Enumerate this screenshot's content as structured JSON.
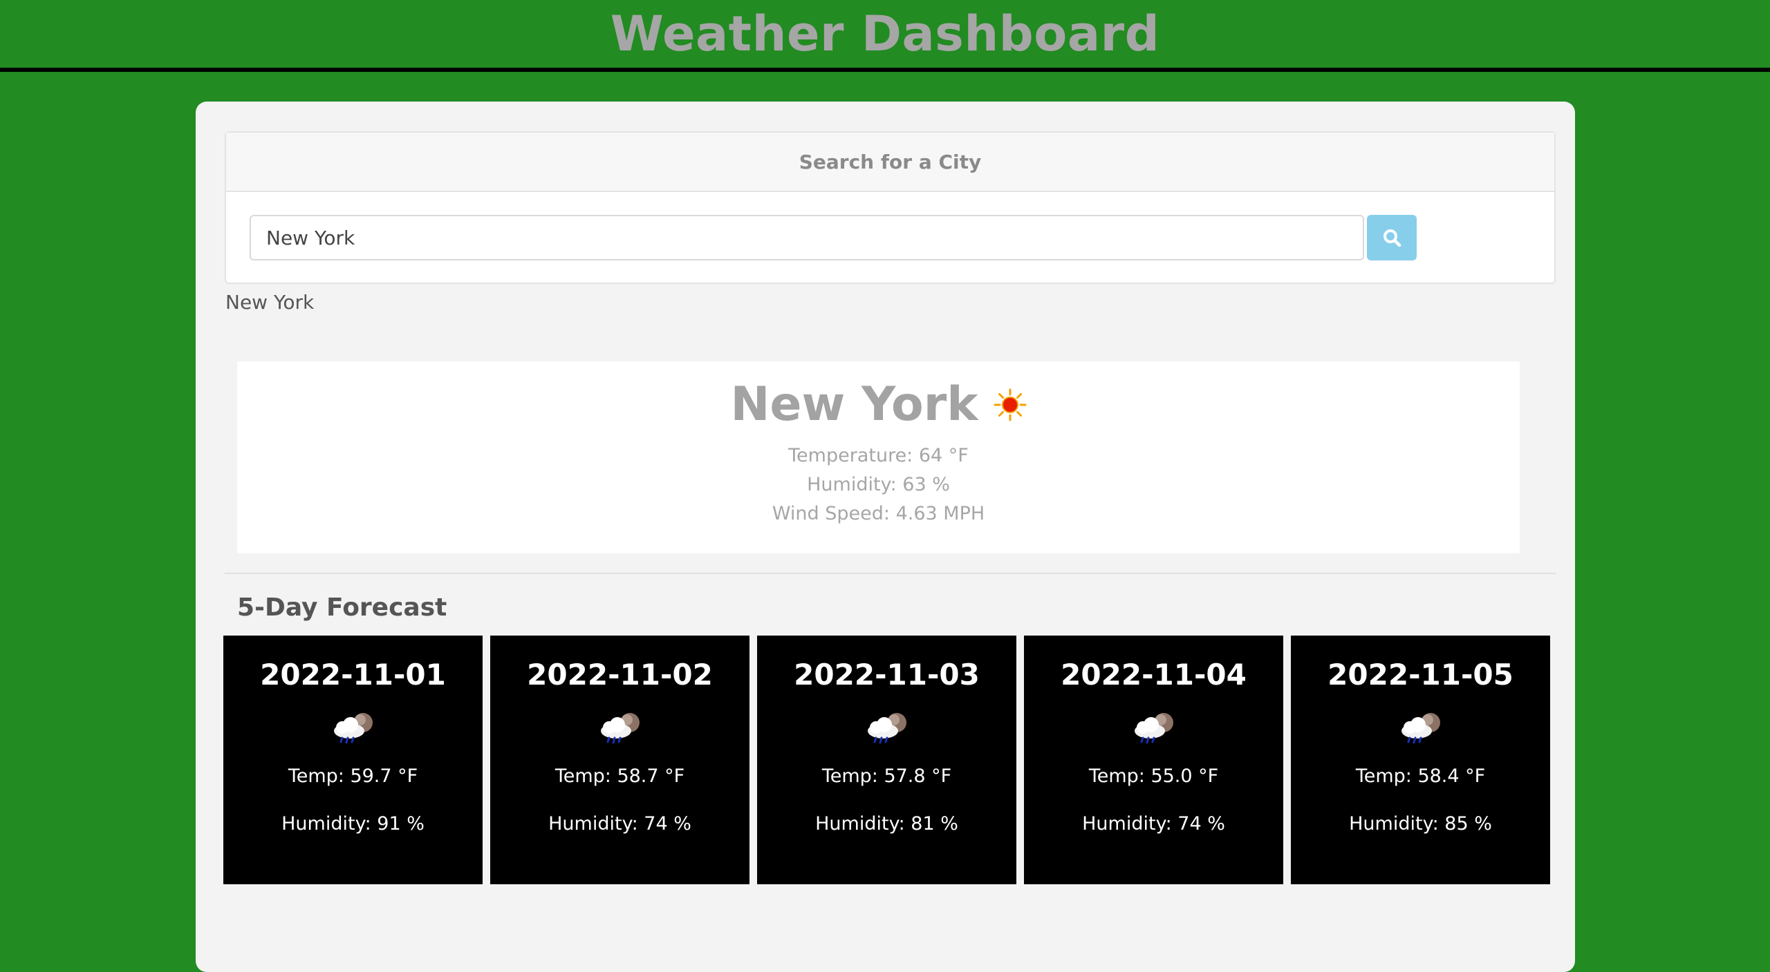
{
  "header": {
    "title": "Weather Dashboard"
  },
  "search": {
    "heading": "Search for a City",
    "input_value": "New York",
    "button_icon": "search-icon"
  },
  "history": [
    "New York"
  ],
  "current": {
    "city": "New York",
    "icon": "sun-icon",
    "temperature": "Temperature: 64 °F",
    "humidity": "Humidity: 63 %",
    "wind": "Wind Speed: 4.63 MPH"
  },
  "forecast": {
    "title": "5-Day Forecast",
    "days": [
      {
        "date": "2022-11-01",
        "icon": "rain-cloud-icon",
        "temp": "Temp: 59.7 °F",
        "humidity": "Humidity: 91 %"
      },
      {
        "date": "2022-11-02",
        "icon": "rain-cloud-icon",
        "temp": "Temp: 58.7 °F",
        "humidity": "Humidity: 74 %"
      },
      {
        "date": "2022-11-03",
        "icon": "rain-cloud-icon",
        "temp": "Temp: 57.8 °F",
        "humidity": "Humidity: 81 %"
      },
      {
        "date": "2022-11-04",
        "icon": "rain-cloud-icon",
        "temp": "Temp: 55.0 °F",
        "humidity": "Humidity: 74 %"
      },
      {
        "date": "2022-11-05",
        "icon": "rain-cloud-icon",
        "temp": "Temp: 58.4 °F",
        "humidity": "Humidity: 85 %"
      }
    ]
  },
  "colors": {
    "background": "#228b22",
    "header_text": "#a6a6a6",
    "search_button": "#87ceeb",
    "forecast_card": "#000000"
  }
}
